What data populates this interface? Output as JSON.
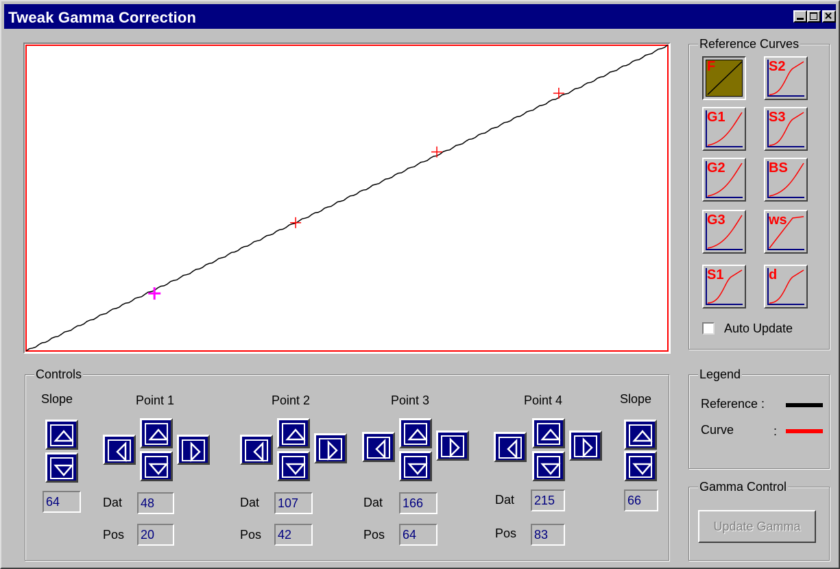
{
  "window": {
    "title": "Tweak Gamma Correction"
  },
  "reference_curves": {
    "title": "Reference Curves",
    "buttons": [
      "F",
      "S2",
      "G1",
      "S3",
      "G2",
      "BS",
      "G3",
      "ws",
      "S1",
      "d"
    ],
    "active": "F",
    "auto_update_label": "Auto Update",
    "auto_update_checked": false
  },
  "controls": {
    "title": "Controls",
    "slope_left": {
      "label": "Slope",
      "value": "64"
    },
    "slope_right": {
      "label": "Slope",
      "value": "66"
    },
    "dat_label": "Dat",
    "pos_label": "Pos",
    "points": [
      {
        "label": "Point 1",
        "dat": "48",
        "pos": "20"
      },
      {
        "label": "Point 2",
        "dat": "107",
        "pos": "42"
      },
      {
        "label": "Point 3",
        "dat": "166",
        "pos": "64"
      },
      {
        "label": "Point 4",
        "dat": "215",
        "pos": "83"
      }
    ]
  },
  "legend": {
    "title": "Legend",
    "reference_label": "Reference :",
    "curve_label": "Curve",
    "curve_colon": ":",
    "reference_color": "#000000",
    "curve_color": "#ff0000"
  },
  "gamma_control": {
    "title": "Gamma Control",
    "update_button": "Update Gamma",
    "update_enabled": false
  },
  "colors": {
    "titlebar": "#000080",
    "selected_marker": "#ff00ff",
    "marker": "#ff0000"
  }
}
